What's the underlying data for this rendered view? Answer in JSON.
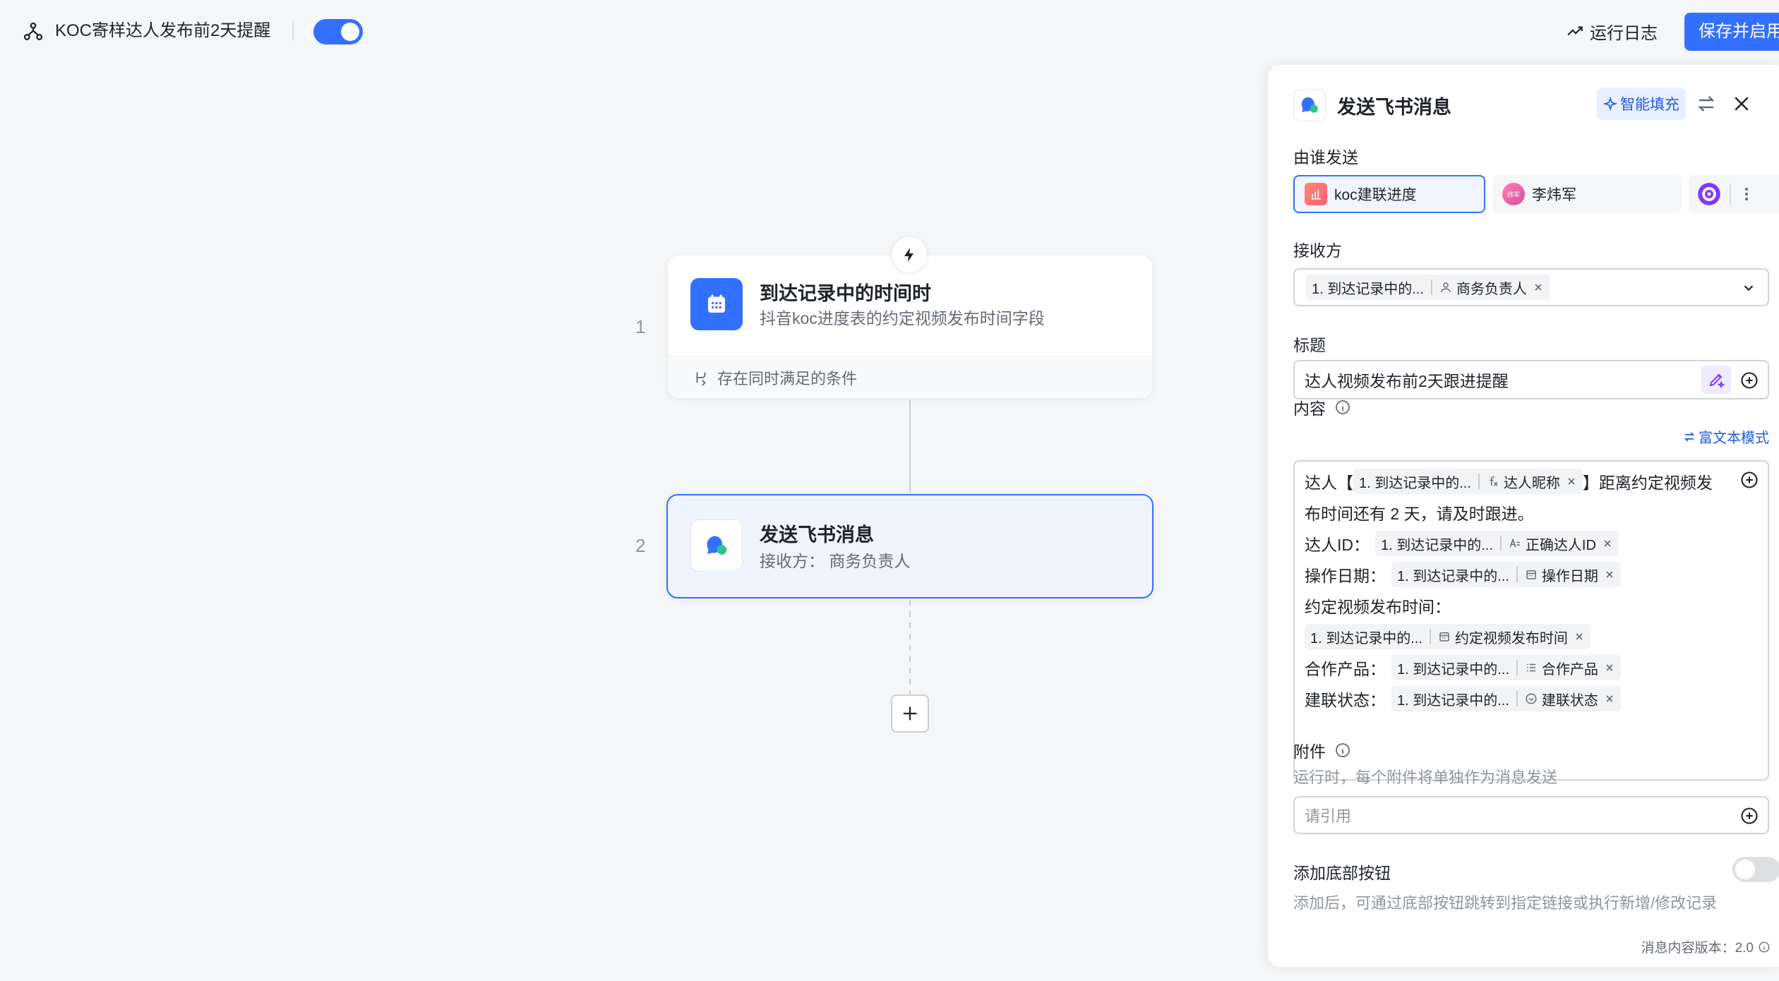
{
  "header": {
    "workflow_title": "KOC寄样达人发布前2天提醒",
    "enabled": true,
    "run_log_label": "运行日志",
    "save_label": "保存并启用"
  },
  "flow": {
    "nodes": [
      {
        "index": "1",
        "title": "到达记录中的时间时",
        "subtitle": "抖音koc进度表的约定视频发布时间字段",
        "footer": "存在同时满足的条件",
        "icon": "calendar-icon"
      },
      {
        "index": "2",
        "title": "发送飞书消息",
        "subtitle": "接收方：  商务负责人",
        "icon": "feishu-message-icon"
      }
    ]
  },
  "panel": {
    "title": "发送飞书消息",
    "smart_fill_label": "智能填充",
    "sender": {
      "label": "由谁发送",
      "options": [
        {
          "name": "koc建联进度",
          "selected": true
        },
        {
          "name": "李炜军",
          "avatar_text": "炜军",
          "selected": false
        }
      ]
    },
    "receiver": {
      "label": "接收方",
      "tag_source": "1. 到达记录中的...",
      "tag_field": "商务负责人"
    },
    "message_title": {
      "label": "标题",
      "value": "达人视频发布前2天跟进提醒"
    },
    "content": {
      "label": "内容",
      "rich_mode_label": "富文本模式",
      "line1_prefix": "达人【",
      "line1_tag_source": "1. 到达记录中的...",
      "line1_tag_field": "达人昵称",
      "line1_suffix": "】距离约定视频发",
      "line2": "布时间还有 2 天，请及时跟进。",
      "fields": [
        {
          "label": "达人ID：",
          "tag_source": "1. 到达记录中的...",
          "tag_field": "正确达人ID"
        },
        {
          "label": "操作日期：",
          "tag_source": "1. 到达记录中的...",
          "tag_field": "操作日期"
        },
        {
          "label": "约定视频发布时间：",
          "tag_source": "1. 到达记录中的...",
          "tag_field": "约定视频发布时间"
        },
        {
          "label": "合作产品：",
          "tag_source": "1. 到达记录中的...",
          "tag_field": "合作产品"
        },
        {
          "label": "建联状态：",
          "tag_source": "1. 到达记录中的...",
          "tag_field": "建联状态"
        }
      ]
    },
    "attachment": {
      "label": "附件",
      "hint": "运行时，每个附件将单独作为消息发送",
      "placeholder": "请引用"
    },
    "bottom_button": {
      "label": "添加底部按钮",
      "hint": "添加后，可通过底部按钮跳转到指定链接或执行新增/修改记录",
      "enabled": false
    },
    "version_text": "消息内容版本：2.0"
  },
  "colors": {
    "accent": "#3370ff",
    "selected_node_bg": "#eff4ff",
    "link": "#245bdb"
  }
}
